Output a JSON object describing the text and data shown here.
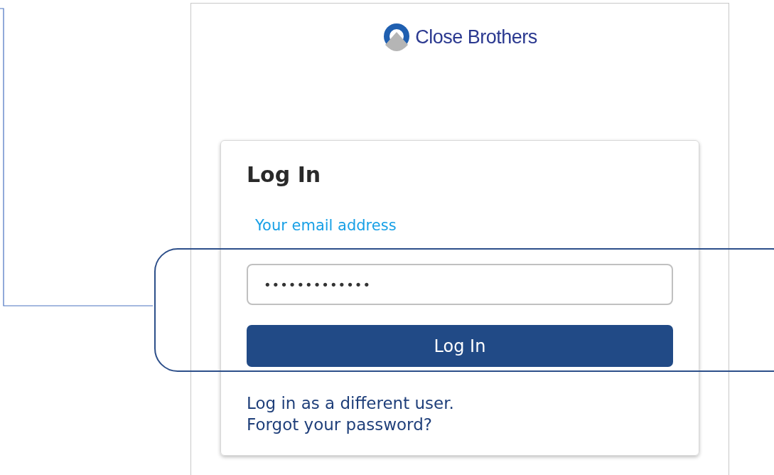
{
  "logo": {
    "text": "Close Brothers"
  },
  "login": {
    "title": "Log In",
    "email_label": "Your email address",
    "password": {
      "value": "•••••••••••••"
    },
    "button": "Log In",
    "links": [
      "Log in as a different user.",
      "Forgot your password?"
    ]
  }
}
